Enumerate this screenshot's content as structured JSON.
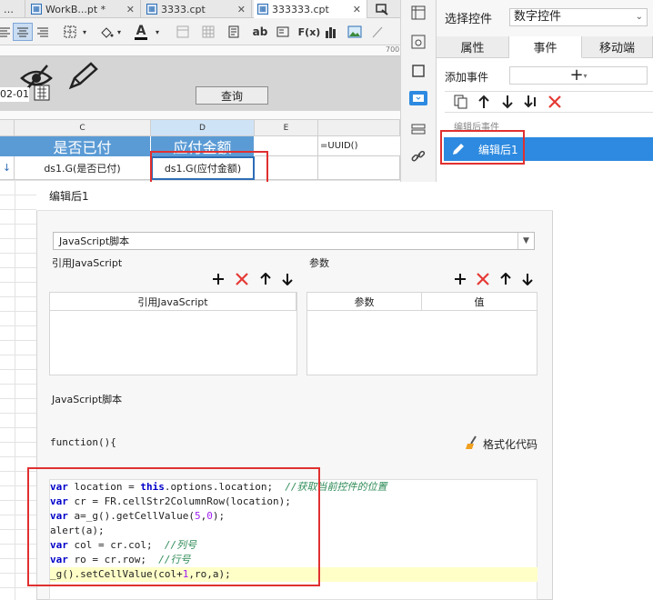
{
  "tabs": [
    {
      "label": "WorkB...pt *",
      "close": "✕"
    },
    {
      "label": "3333.cpt",
      "close": "✕"
    },
    {
      "label": "333333.cpt",
      "close": "✕"
    }
  ],
  "toolbar": {
    "text_ab": "ab",
    "fx": "F(x)",
    "font_color_letter": "A"
  },
  "ruler": {
    "mark": "700"
  },
  "param_panel": {
    "date_fragment": "02-01",
    "query_button": "查询"
  },
  "sheet": {
    "columns": [
      "C",
      "D",
      "E"
    ],
    "header_cells": [
      "是否已付",
      "应付金额"
    ],
    "formula_cells": [
      "ds1.G(是否已付)",
      "ds1.G(应付金额)"
    ],
    "uuid_cell": "=UUID()"
  },
  "right_panel": {
    "select_label": "选择控件",
    "select_value": "数字控件",
    "tabs": [
      "属性",
      "事件",
      "移动端"
    ],
    "add_event_label": "添加事件",
    "add_event_button": "+",
    "section_label": "编辑后事件",
    "event_item": "编辑后1"
  },
  "dialog": {
    "title": "编辑后1",
    "script_type": "JavaScript脚本",
    "ref_js_label": "引用JavaScript",
    "params_label": "参数",
    "ref_js_header": "引用JavaScript",
    "param_header": "参数",
    "value_header": "值",
    "script_label": "JavaScript脚本",
    "function_header": "function(){",
    "format_button": "格式化代码"
  },
  "code_lines": [
    "var location = this.options.location;  //获取当前控件的位置",
    "var cr = FR.cellStr2ColumnRow(location);",
    "var a=_g().getCellValue(5,0);",
    "alert(a);",
    "var col = cr.col;  //列号",
    "var ro = cr.row;  //行号",
    "_g().setCellValue(col+1,ro,a);"
  ],
  "colors": {
    "header_blue": "#5b9bd5",
    "highlight_red": "#e03030",
    "selected_blue": "#2d8ae0"
  }
}
